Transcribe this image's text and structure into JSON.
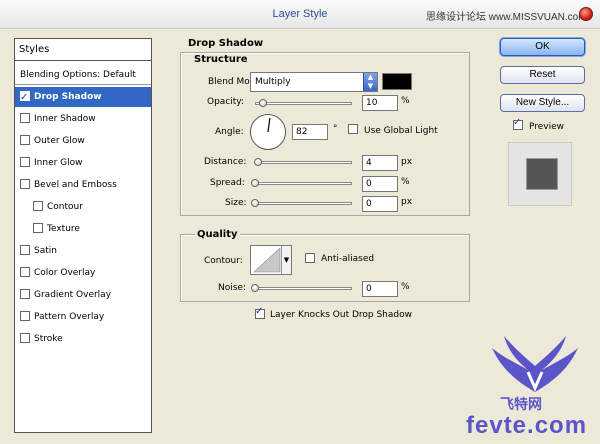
{
  "window": {
    "title": "Layer Style",
    "watermark_top": "思缘设计论坛 www.MISSVUAN.com"
  },
  "styles": {
    "header": "Styles",
    "items": [
      {
        "label": "Blending Options: Default",
        "has_checkbox": false,
        "checked": false,
        "selected": false,
        "indent": false
      },
      {
        "label": "Drop Shadow",
        "has_checkbox": true,
        "checked": true,
        "selected": true,
        "indent": false
      },
      {
        "label": "Inner Shadow",
        "has_checkbox": true,
        "checked": false,
        "selected": false,
        "indent": false
      },
      {
        "label": "Outer Glow",
        "has_checkbox": true,
        "checked": false,
        "selected": false,
        "indent": false
      },
      {
        "label": "Inner Glow",
        "has_checkbox": true,
        "checked": false,
        "selected": false,
        "indent": false
      },
      {
        "label": "Bevel and Emboss",
        "has_checkbox": true,
        "checked": false,
        "selected": false,
        "indent": false
      },
      {
        "label": "Contour",
        "has_checkbox": true,
        "checked": false,
        "selected": false,
        "indent": true
      },
      {
        "label": "Texture",
        "has_checkbox": true,
        "checked": false,
        "selected": false,
        "indent": true
      },
      {
        "label": "Satin",
        "has_checkbox": true,
        "checked": false,
        "selected": false,
        "indent": false
      },
      {
        "label": "Color Overlay",
        "has_checkbox": true,
        "checked": false,
        "selected": false,
        "indent": false
      },
      {
        "label": "Gradient Overlay",
        "has_checkbox": true,
        "checked": false,
        "selected": false,
        "indent": false
      },
      {
        "label": "Pattern Overlay",
        "has_checkbox": true,
        "checked": false,
        "selected": false,
        "indent": false
      },
      {
        "label": "Stroke",
        "has_checkbox": true,
        "checked": false,
        "selected": false,
        "indent": false
      }
    ]
  },
  "drop_shadow": {
    "title": "Drop Shadow",
    "structure": {
      "title": "Structure",
      "blend_mode_label": "Blend Mode:",
      "blend_mode_value": "Multiply",
      "shadow_color": "#000000",
      "opacity_label": "Opacity:",
      "opacity_value": "10",
      "opacity_unit": "%",
      "angle_label": "Angle:",
      "angle_value": "82",
      "angle_unit": "°",
      "use_global_light_label": "Use Global Light",
      "use_global_light_checked": false,
      "distance_label": "Distance:",
      "distance_value": "4",
      "distance_unit": "px",
      "spread_label": "Spread:",
      "spread_value": "0",
      "spread_unit": "%",
      "size_label": "Size:",
      "size_value": "0",
      "size_unit": "px"
    },
    "quality": {
      "title": "Quality",
      "contour_label": "Contour:",
      "anti_aliased_label": "Anti-aliased",
      "anti_aliased_checked": false,
      "noise_label": "Noise:",
      "noise_value": "0",
      "noise_unit": "%"
    },
    "knockout_label": "Layer Knocks Out Drop Shadow",
    "knockout_checked": true
  },
  "buttons": {
    "ok": "OK",
    "reset": "Reset",
    "new_style": "New Style..."
  },
  "preview": {
    "label": "Preview",
    "checked": true
  },
  "watermark": {
    "line1": "飞特网",
    "line2": "fevte.com"
  }
}
